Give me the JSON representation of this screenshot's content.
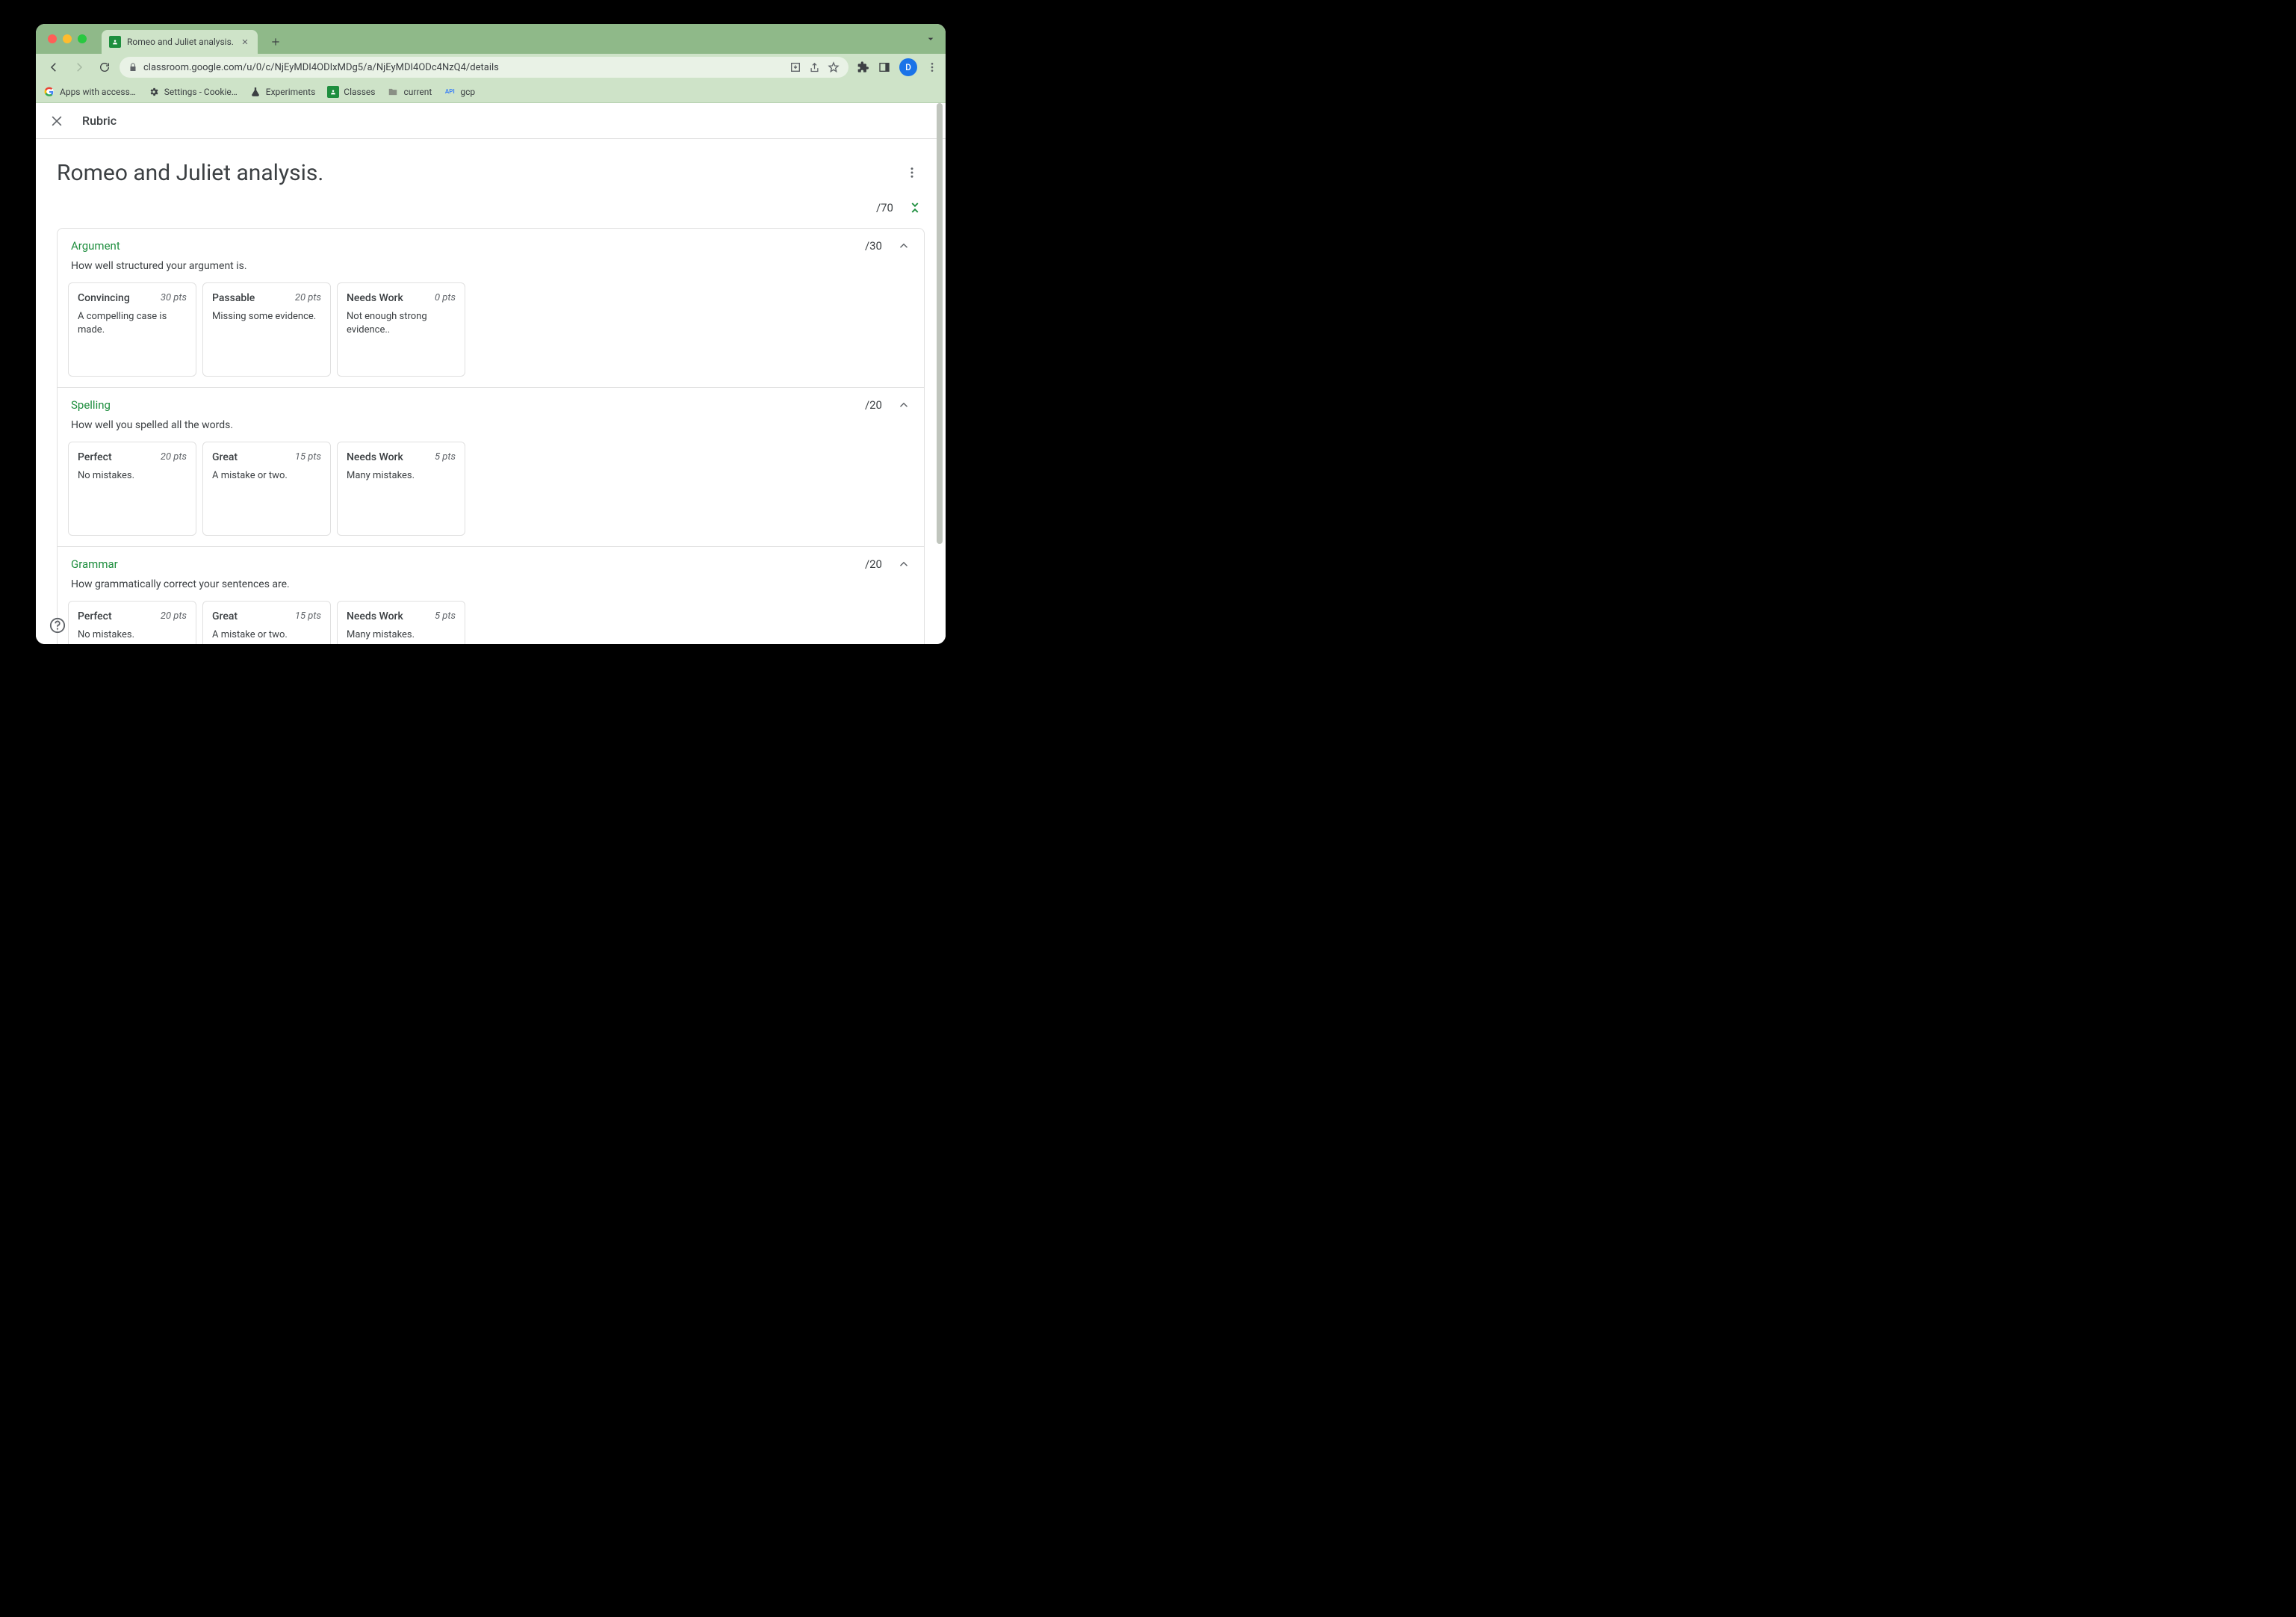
{
  "browser": {
    "tab_title": "Romeo and Juliet analysis.",
    "url": "classroom.google.com/u/0/c/NjEyMDI4ODIxMDg5/a/NjEyMDI4ODc4NzQ4/details",
    "avatar_letter": "D",
    "bookmarks": [
      {
        "label": "Apps with access…"
      },
      {
        "label": "Settings - Cookie…"
      },
      {
        "label": "Experiments"
      },
      {
        "label": "Classes"
      },
      {
        "label": "current"
      },
      {
        "label": "gcp"
      }
    ]
  },
  "header": {
    "title": "Rubric"
  },
  "rubric": {
    "title": "Romeo and Juliet analysis.",
    "total_points": "/70",
    "criteria": [
      {
        "name": "Argument",
        "points": "/30",
        "description": "How well structured your argument is.",
        "levels": [
          {
            "name": "Convincing",
            "pts": "30 pts",
            "desc": "A compelling case is made."
          },
          {
            "name": "Passable",
            "pts": "20 pts",
            "desc": "Missing some evidence."
          },
          {
            "name": "Needs Work",
            "pts": "0 pts",
            "desc": "Not enough strong evidence.."
          }
        ]
      },
      {
        "name": "Spelling",
        "points": "/20",
        "description": "How well you spelled all the words.",
        "levels": [
          {
            "name": "Perfect",
            "pts": "20 pts",
            "desc": "No mistakes."
          },
          {
            "name": "Great",
            "pts": "15 pts",
            "desc": "A mistake or two."
          },
          {
            "name": "Needs Work",
            "pts": "5 pts",
            "desc": "Many mistakes."
          }
        ]
      },
      {
        "name": "Grammar",
        "points": "/20",
        "description": "How grammatically correct your sentences are.",
        "levels": [
          {
            "name": "Perfect",
            "pts": "20 pts",
            "desc": "No mistakes."
          },
          {
            "name": "Great",
            "pts": "15 pts",
            "desc": "A mistake or two."
          },
          {
            "name": "Needs Work",
            "pts": "5 pts",
            "desc": "Many mistakes."
          }
        ]
      }
    ]
  }
}
